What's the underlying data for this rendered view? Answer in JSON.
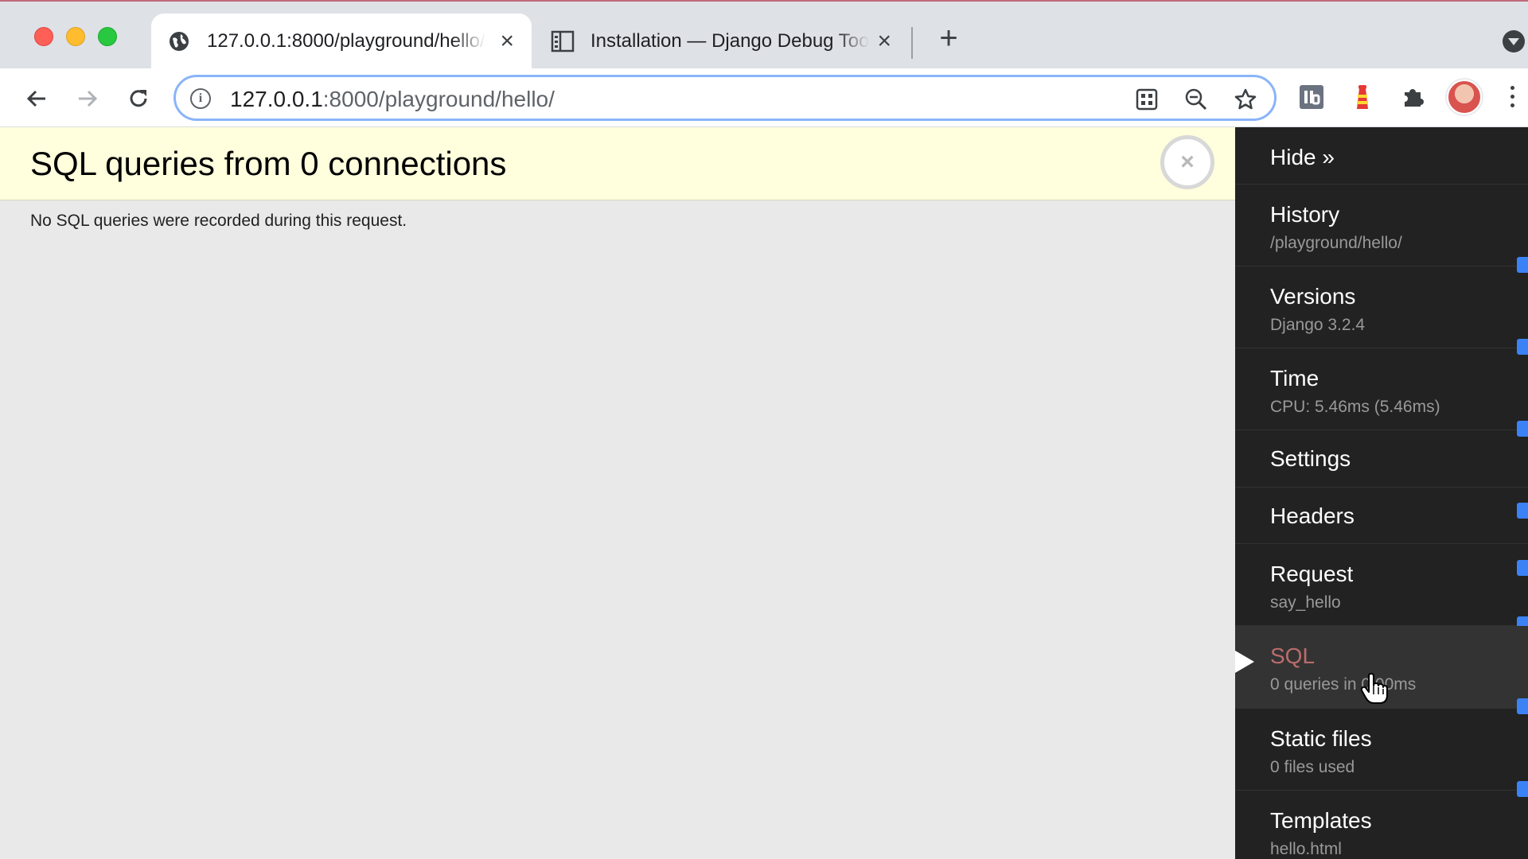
{
  "browser": {
    "tabs": [
      {
        "title": "127.0.0.1:8000/playground/hello/",
        "close": "×",
        "active": true,
        "favicon": "globe-icon"
      },
      {
        "title": "Installation — Django Debug Toolbar",
        "close": "×",
        "active": false,
        "favicon": "docs-icon"
      }
    ],
    "new_tab": "+",
    "address": {
      "host": "127.0.0.1",
      "rest": ":8000/playground/hello/",
      "info_glyph": "i"
    }
  },
  "panel": {
    "title": "SQL queries from 0 connections",
    "close": "×",
    "message": "No SQL queries were recorded during this request."
  },
  "toolbar": {
    "hide_label": "Hide »",
    "items": [
      {
        "name": "History",
        "subtitle": "/playground/hello/"
      },
      {
        "name": "Versions",
        "subtitle": "Django 3.2.4"
      },
      {
        "name": "Time",
        "subtitle": "CPU: 5.46ms (5.46ms)"
      },
      {
        "name": "Settings",
        "subtitle": ""
      },
      {
        "name": "Headers",
        "subtitle": ""
      },
      {
        "name": "Request",
        "subtitle": "say_hello"
      },
      {
        "name": "SQL",
        "subtitle": "0 queries in 0.00ms",
        "active": true
      },
      {
        "name": "Static files",
        "subtitle": "0 files used"
      },
      {
        "name": "Templates",
        "subtitle": "hello.html"
      }
    ]
  },
  "colors": {
    "panel_header_bg": "#ffffdd",
    "toolbar_bg": "#222222",
    "active_item_text": "#bb6c6c",
    "checkbox_blue": "#3b82f6"
  }
}
